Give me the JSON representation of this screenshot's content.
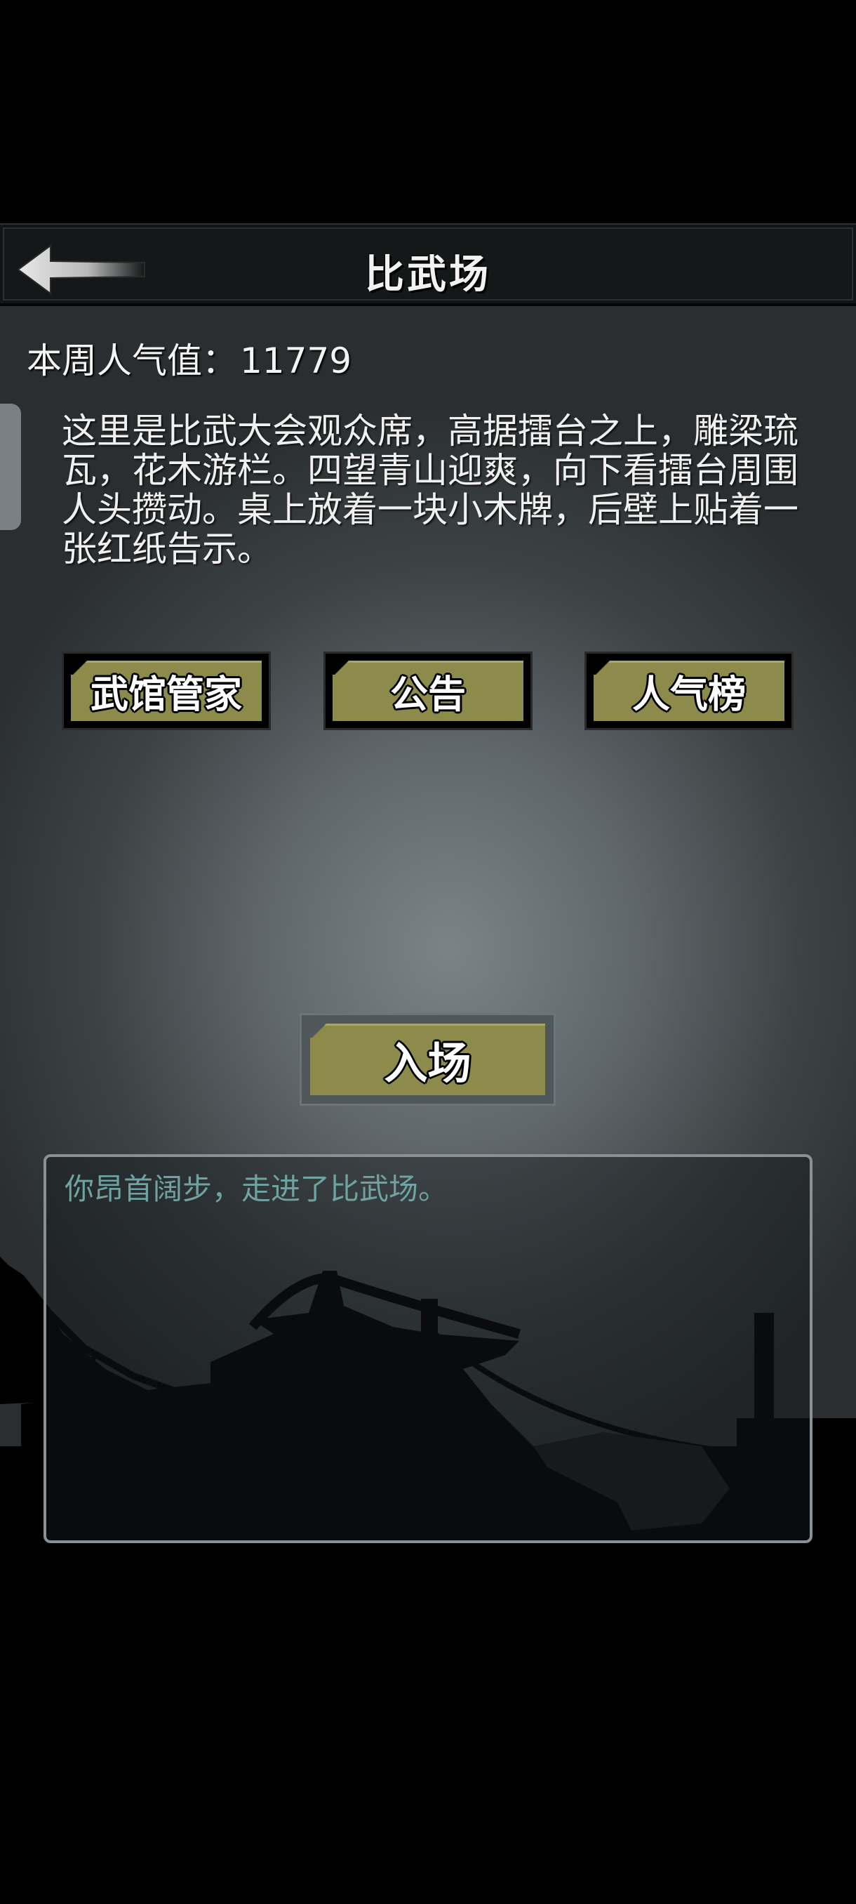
{
  "header": {
    "title": "比武场",
    "back_icon": "back-arrow-icon"
  },
  "popularity": {
    "label": "本周人气值：",
    "value": "11779"
  },
  "description": "这里是比武大会观众席，高据擂台之上，雕梁琉瓦，花木游栏。四望青山迎爽，向下看擂台周围人头攒动。桌上放着一块小木牌，后壁上贴着一张红纸告示。",
  "buttons": {
    "manager": "武馆管家",
    "notice": "公告",
    "ranking": "人气榜",
    "enter": "入场"
  },
  "log": {
    "message": "你昂首阔步，走进了比武场。"
  },
  "colors": {
    "button_face": "#8d8b4c",
    "log_text": "#6fa3a2"
  }
}
